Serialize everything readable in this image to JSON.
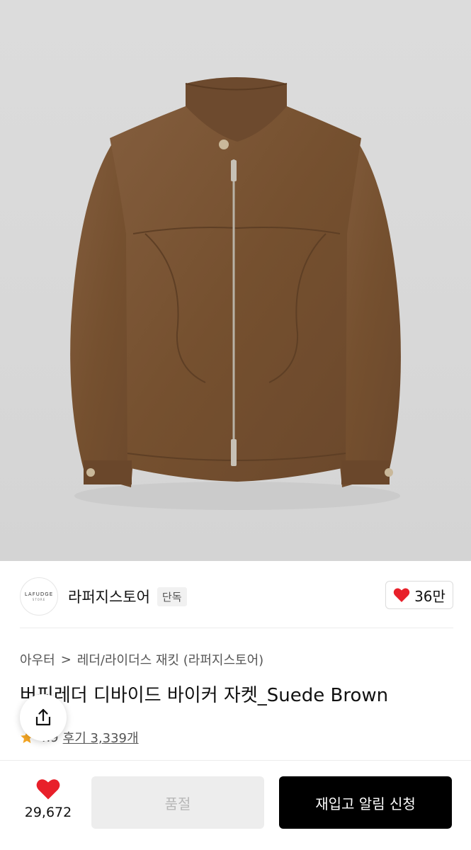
{
  "brand": {
    "logo_text": "LAFUDGE",
    "logo_sub": "STORE",
    "name": "라퍼지스토어",
    "badge": "단독",
    "likes": "36만"
  },
  "breadcrumb": {
    "category": "아우터",
    "separator": ">",
    "subcategory": "레더/라이더스 재킷 (라퍼지스토어)"
  },
  "product": {
    "title": "버핀레더 디바이드 바이커 자켓_Suede Brown",
    "rating": "4.9",
    "reviews": "후기 3,339개"
  },
  "bottom_bar": {
    "favorites_count": "29,672",
    "soldout_label": "품절",
    "restock_label": "재입고 알림 신청"
  },
  "colors": {
    "heart": "#e8202a",
    "star": "#f5a623",
    "jacket": "#7a5638"
  }
}
